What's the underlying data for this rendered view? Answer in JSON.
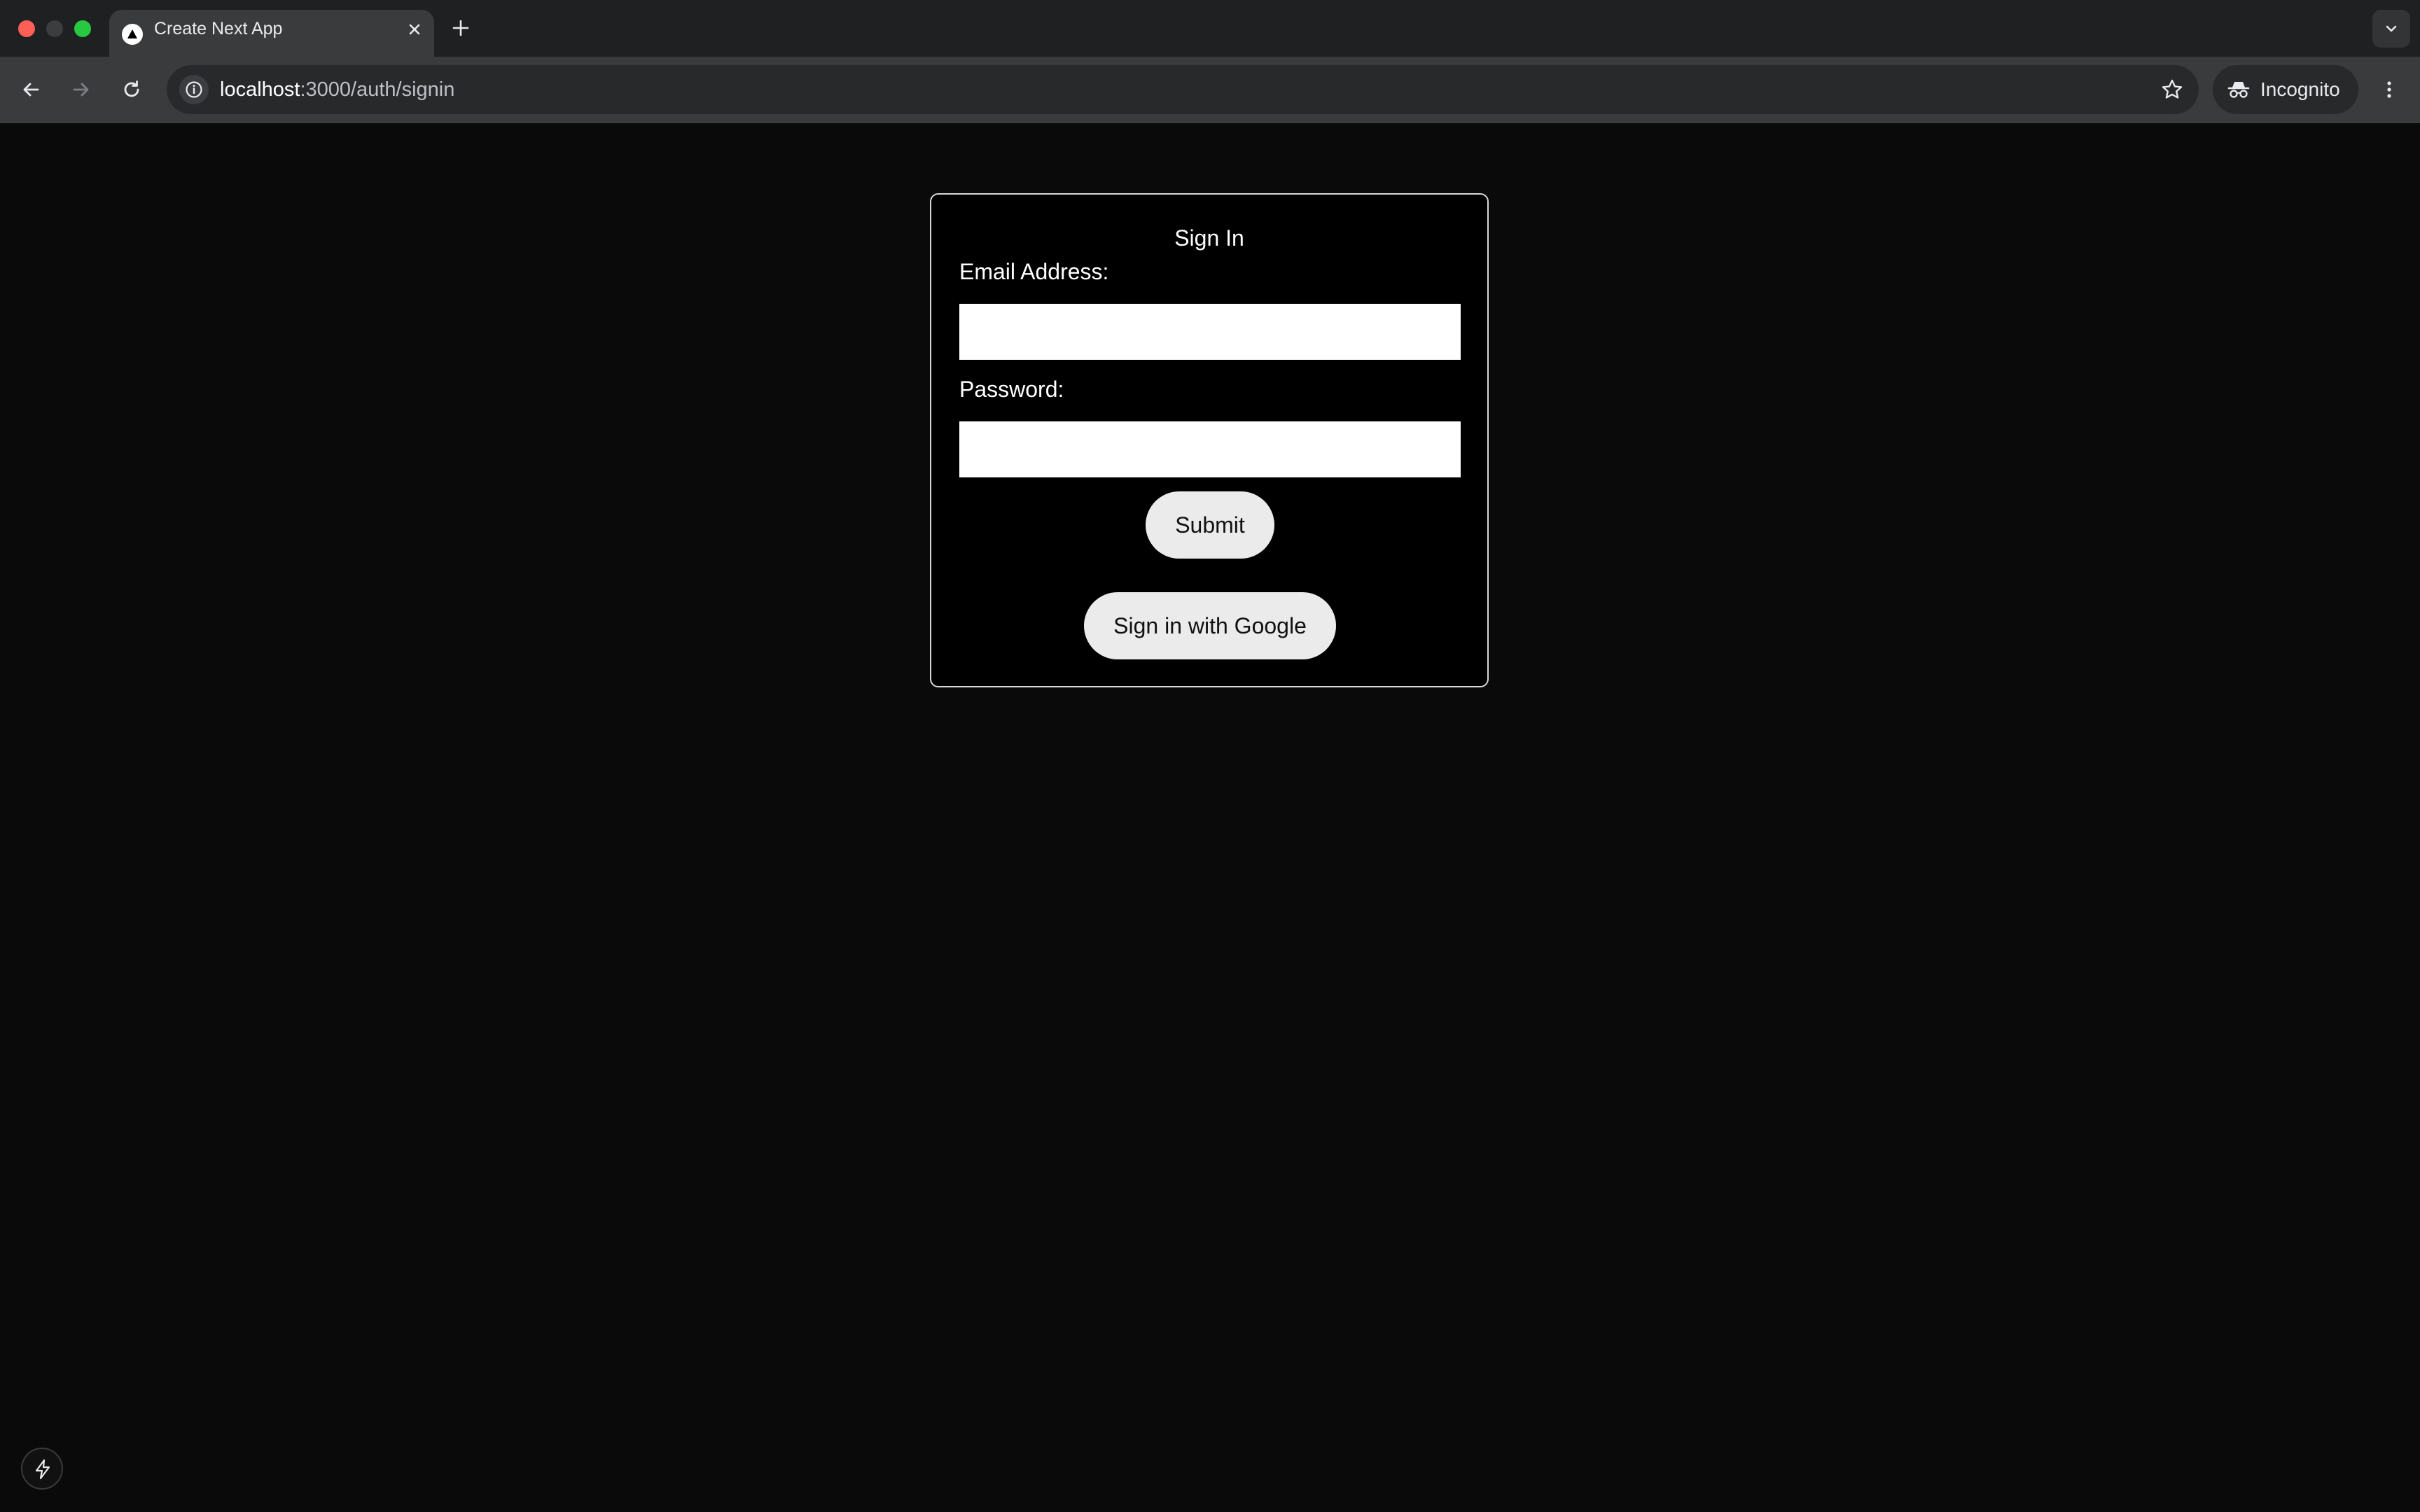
{
  "browser": {
    "tab": {
      "title": "Create Next App"
    },
    "address_bar": {
      "host": "localhost",
      "path": ":3000/auth/signin"
    },
    "profile": {
      "label": "Incognito"
    }
  },
  "icons": {
    "favicon": "nextjs-triangle-icon",
    "close": "close-icon",
    "new_tab": "plus-icon",
    "tab_search": "chevron-down-icon",
    "back": "arrow-left-icon",
    "forward": "arrow-right-icon",
    "reload": "reload-icon",
    "site_info": "info-icon",
    "bookmark": "star-icon",
    "incognito": "incognito-icon",
    "menu": "kebab-menu-icon",
    "dev_tools": "lightning-bolt-icon"
  },
  "form": {
    "title": "Sign In",
    "email_label": "Email Address:",
    "email_value": "",
    "password_label": "Password:",
    "password_value": "",
    "submit_label": "Submit",
    "google_label": "Sign in with Google"
  },
  "colors": {
    "page_background": "#0a0a0a",
    "card_background": "#000000",
    "card_border": "#d9d9d9",
    "button_background": "#ebebeb",
    "input_background": "#ffffff"
  }
}
